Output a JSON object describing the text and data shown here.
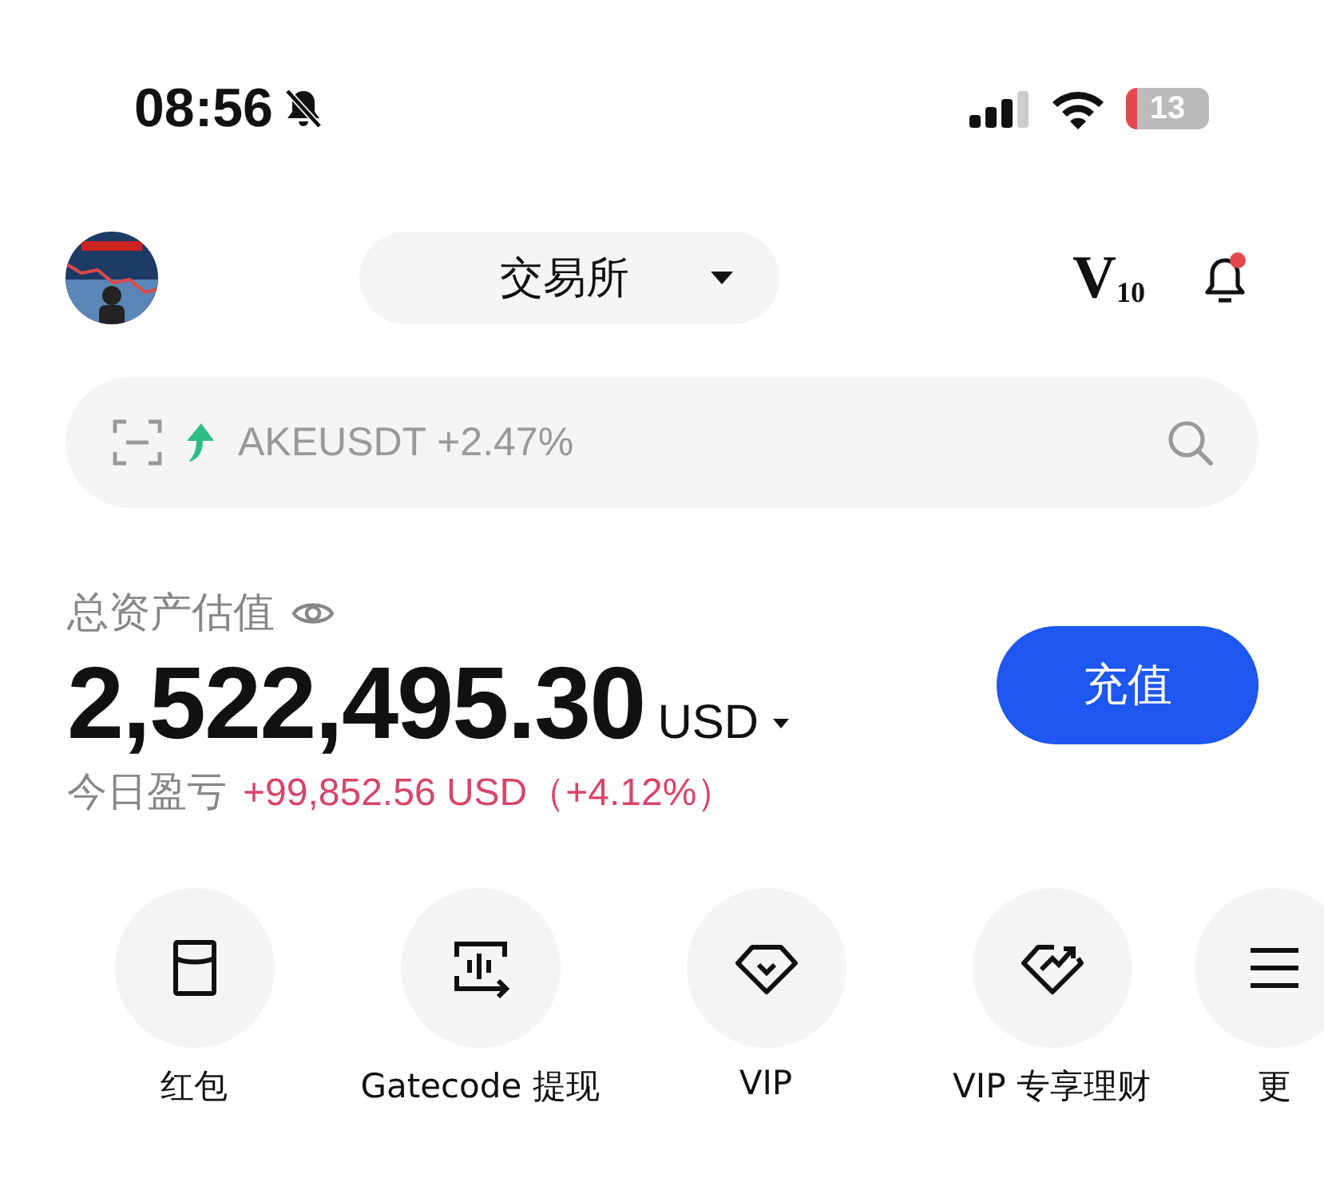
{
  "status_bar": {
    "time": "08:56",
    "battery": "13"
  },
  "header": {
    "exchange": "交易所",
    "vip_level": "V",
    "vip_number": "10",
    "notification_dot": true
  },
  "search": {
    "placeholder": "AKEUSDT +2.47%"
  },
  "assets": {
    "label": "总资产估值",
    "total": "2,522,495.30",
    "currency": "USD",
    "deposit_button": "充值",
    "pnl_label": "今日盈亏",
    "pnl_value": "+99,852.56 USD（+4.12%）"
  },
  "shortcuts": [
    {
      "kind": "envelope",
      "label": "红包"
    },
    {
      "kind": "code",
      "label": "Gatecode 提现"
    },
    {
      "kind": "vip",
      "label": "VIP"
    },
    {
      "kind": "vipchart",
      "label": "VIP 专享理财"
    },
    {
      "kind": "more",
      "label": "更"
    }
  ]
}
